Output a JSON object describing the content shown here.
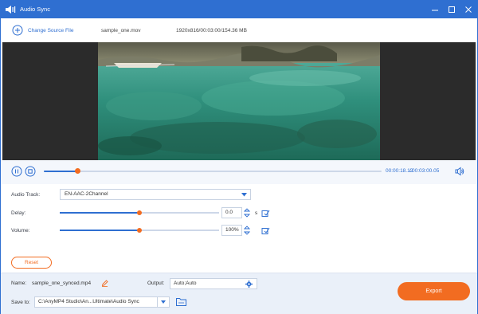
{
  "titlebar": {
    "title": "Audio Sync",
    "icons": [
      "audio-sync-logo-icon",
      "minimize-icon",
      "maximize-icon",
      "close-icon"
    ]
  },
  "source": {
    "change_label": "Change Source File",
    "file_name": "sample_one.mov",
    "file_meta": "1920x816/00:03:00/154.36 MB"
  },
  "playback": {
    "current_time": "00:00:18.12",
    "separator": "/",
    "total_time": "00:03:00.05",
    "progress": 0.1
  },
  "settings": {
    "audio_track": {
      "label": "Audio Track:",
      "value": "EN-AAC-2Channel"
    },
    "delay": {
      "label": "Delay:",
      "value": "0.0",
      "unit": "s",
      "level": 0.5
    },
    "volume": {
      "label": "Volume:",
      "value": "100%",
      "level": 0.5
    },
    "reset_label": "Reset"
  },
  "bottom": {
    "name_label": "Name:",
    "name_value": "sample_one_synced.mp4",
    "output_label": "Output:",
    "output_value": "Auto;Auto",
    "saveto_label": "Save to:",
    "saveto_value": "C:\\AnyMP4 Studio\\An...Ultimate\\Audio Sync",
    "export_label": "Export"
  },
  "colors": {
    "brand_blue": "#2f6fd1",
    "accent_orange": "#f26c21"
  }
}
